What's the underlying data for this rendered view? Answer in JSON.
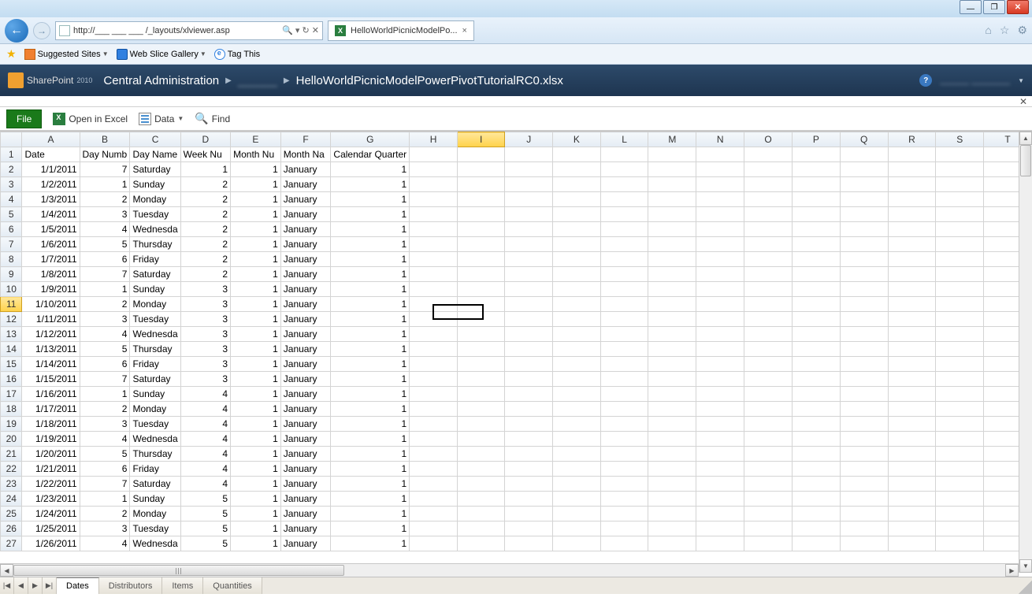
{
  "browser": {
    "url": "http://___ ___ ___ /_layouts/xlviewer.asp",
    "search_icons": "🔍 ▾ ↻ ✕",
    "tab_title": "HelloWorldPicnicModelPo...",
    "tab_close": "×",
    "icons": {
      "home": "⌂",
      "star": "☆",
      "gear": "⚙"
    }
  },
  "favorites": {
    "suggested": "Suggested Sites",
    "webslice": "Web Slice Gallery",
    "tagthis": "Tag This"
  },
  "sharepoint": {
    "brand": "SharePoint",
    "year": "2010",
    "crumb1": "Central Administration",
    "crumb2_blur": "______",
    "crumb3": "HelloWorldPicnicModelPowerPivotTutorialRC0.xlsx",
    "user_blur": "______ ________",
    "help": "?"
  },
  "toolbar": {
    "file": "File",
    "open": "Open in Excel",
    "data": "Data",
    "find": "Find"
  },
  "columns": [
    "A",
    "B",
    "C",
    "D",
    "E",
    "F",
    "G",
    "H",
    "I",
    "J",
    "K",
    "L",
    "M",
    "N",
    "O",
    "P",
    "Q",
    "R",
    "S",
    "T"
  ],
  "headers": [
    "Date",
    "Day Numb",
    "Day Name",
    "Week Nu",
    "Month Nu",
    "Month Na",
    "Calendar Quarter"
  ],
  "active": {
    "col": "I",
    "row": 11
  },
  "rows": [
    {
      "n": 2,
      "date": "1/1/2011",
      "dn": 7,
      "dname": "Saturday",
      "wk": 1,
      "mn": 1,
      "mname": "January",
      "q": 1
    },
    {
      "n": 3,
      "date": "1/2/2011",
      "dn": 1,
      "dname": "Sunday",
      "wk": 2,
      "mn": 1,
      "mname": "January",
      "q": 1
    },
    {
      "n": 4,
      "date": "1/3/2011",
      "dn": 2,
      "dname": "Monday",
      "wk": 2,
      "mn": 1,
      "mname": "January",
      "q": 1
    },
    {
      "n": 5,
      "date": "1/4/2011",
      "dn": 3,
      "dname": "Tuesday",
      "wk": 2,
      "mn": 1,
      "mname": "January",
      "q": 1
    },
    {
      "n": 6,
      "date": "1/5/2011",
      "dn": 4,
      "dname": "Wednesda",
      "wk": 2,
      "mn": 1,
      "mname": "January",
      "q": 1
    },
    {
      "n": 7,
      "date": "1/6/2011",
      "dn": 5,
      "dname": "Thursday",
      "wk": 2,
      "mn": 1,
      "mname": "January",
      "q": 1
    },
    {
      "n": 8,
      "date": "1/7/2011",
      "dn": 6,
      "dname": "Friday",
      "wk": 2,
      "mn": 1,
      "mname": "January",
      "q": 1
    },
    {
      "n": 9,
      "date": "1/8/2011",
      "dn": 7,
      "dname": "Saturday",
      "wk": 2,
      "mn": 1,
      "mname": "January",
      "q": 1
    },
    {
      "n": 10,
      "date": "1/9/2011",
      "dn": 1,
      "dname": "Sunday",
      "wk": 3,
      "mn": 1,
      "mname": "January",
      "q": 1
    },
    {
      "n": 11,
      "date": "1/10/2011",
      "dn": 2,
      "dname": "Monday",
      "wk": 3,
      "mn": 1,
      "mname": "January",
      "q": 1
    },
    {
      "n": 12,
      "date": "1/11/2011",
      "dn": 3,
      "dname": "Tuesday",
      "wk": 3,
      "mn": 1,
      "mname": "January",
      "q": 1
    },
    {
      "n": 13,
      "date": "1/12/2011",
      "dn": 4,
      "dname": "Wednesda",
      "wk": 3,
      "mn": 1,
      "mname": "January",
      "q": 1
    },
    {
      "n": 14,
      "date": "1/13/2011",
      "dn": 5,
      "dname": "Thursday",
      "wk": 3,
      "mn": 1,
      "mname": "January",
      "q": 1
    },
    {
      "n": 15,
      "date": "1/14/2011",
      "dn": 6,
      "dname": "Friday",
      "wk": 3,
      "mn": 1,
      "mname": "January",
      "q": 1
    },
    {
      "n": 16,
      "date": "1/15/2011",
      "dn": 7,
      "dname": "Saturday",
      "wk": 3,
      "mn": 1,
      "mname": "January",
      "q": 1
    },
    {
      "n": 17,
      "date": "1/16/2011",
      "dn": 1,
      "dname": "Sunday",
      "wk": 4,
      "mn": 1,
      "mname": "January",
      "q": 1
    },
    {
      "n": 18,
      "date": "1/17/2011",
      "dn": 2,
      "dname": "Monday",
      "wk": 4,
      "mn": 1,
      "mname": "January",
      "q": 1
    },
    {
      "n": 19,
      "date": "1/18/2011",
      "dn": 3,
      "dname": "Tuesday",
      "wk": 4,
      "mn": 1,
      "mname": "January",
      "q": 1
    },
    {
      "n": 20,
      "date": "1/19/2011",
      "dn": 4,
      "dname": "Wednesda",
      "wk": 4,
      "mn": 1,
      "mname": "January",
      "q": 1
    },
    {
      "n": 21,
      "date": "1/20/2011",
      "dn": 5,
      "dname": "Thursday",
      "wk": 4,
      "mn": 1,
      "mname": "January",
      "q": 1
    },
    {
      "n": 22,
      "date": "1/21/2011",
      "dn": 6,
      "dname": "Friday",
      "wk": 4,
      "mn": 1,
      "mname": "January",
      "q": 1
    },
    {
      "n": 23,
      "date": "1/22/2011",
      "dn": 7,
      "dname": "Saturday",
      "wk": 4,
      "mn": 1,
      "mname": "January",
      "q": 1
    },
    {
      "n": 24,
      "date": "1/23/2011",
      "dn": 1,
      "dname": "Sunday",
      "wk": 5,
      "mn": 1,
      "mname": "January",
      "q": 1
    },
    {
      "n": 25,
      "date": "1/24/2011",
      "dn": 2,
      "dname": "Monday",
      "wk": 5,
      "mn": 1,
      "mname": "January",
      "q": 1
    },
    {
      "n": 26,
      "date": "1/25/2011",
      "dn": 3,
      "dname": "Tuesday",
      "wk": 5,
      "mn": 1,
      "mname": "January",
      "q": 1
    },
    {
      "n": 27,
      "date": "1/26/2011",
      "dn": 4,
      "dname": "Wednesda",
      "wk": 5,
      "mn": 1,
      "mname": "January",
      "q": 1
    }
  ],
  "sheets": [
    "Dates",
    "Distributors",
    "Items",
    "Quantities"
  ],
  "active_sheet": "Dates"
}
